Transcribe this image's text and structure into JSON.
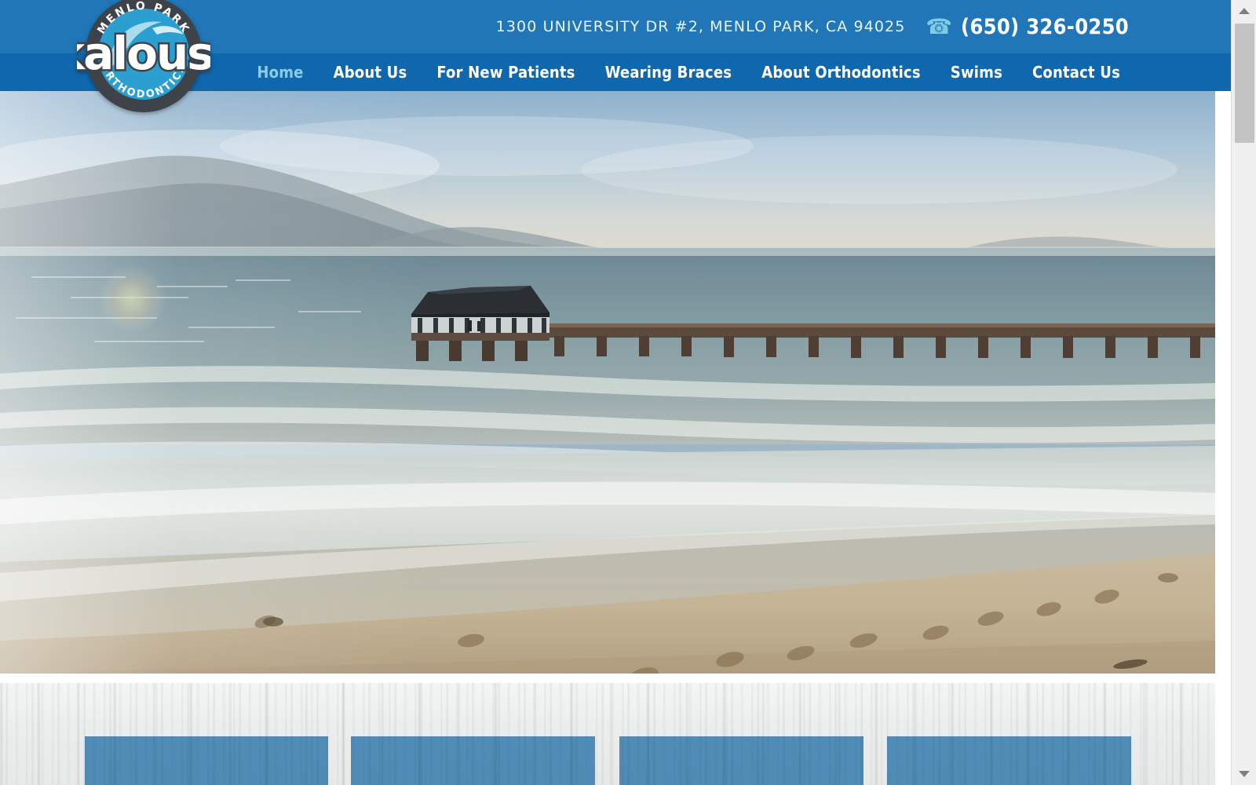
{
  "brand": {
    "logo_top_text": "MENLO PARK",
    "logo_name": "kaloust",
    "logo_bottom_text": "ORTHODONTICS",
    "logo_ring_color": "#3d4349",
    "logo_wave_color": "#2c9fd1"
  },
  "header": {
    "address": "1300 UNIVERSITY DR #2, MENLO PARK, CA 94025",
    "phone": "(650) 326-0250",
    "phone_icon": "telephone-icon",
    "bar_color": "#2176b8"
  },
  "nav": {
    "bar_color": "#0f68ae",
    "active_color": "#8ecbe8",
    "items": [
      {
        "label": "Home",
        "active": true
      },
      {
        "label": "About Us",
        "active": false
      },
      {
        "label": "For New Patients",
        "active": false
      },
      {
        "label": "Wearing Braces",
        "active": false
      },
      {
        "label": "About Orthodontics",
        "active": false
      },
      {
        "label": "Swims",
        "active": false
      },
      {
        "label": "Contact Us",
        "active": false
      }
    ]
  },
  "hero": {
    "name": "beach-pier-photo",
    "description": "Sunlit tropical beach with wooden pier pavilion, mountains in haze, waves and footprints in the sand"
  },
  "lower_section": {
    "background": "whitewashed-wood-texture",
    "box_color": "#4a90c2",
    "boxes": [
      {
        "name": "promo-box-1"
      },
      {
        "name": "promo-box-2"
      },
      {
        "name": "promo-box-3"
      },
      {
        "name": "promo-box-4"
      }
    ]
  },
  "scrollbar": {
    "up_arrow": "scroll-up-arrow",
    "down_arrow": "scroll-down-arrow",
    "thumb": "scroll-thumb"
  }
}
